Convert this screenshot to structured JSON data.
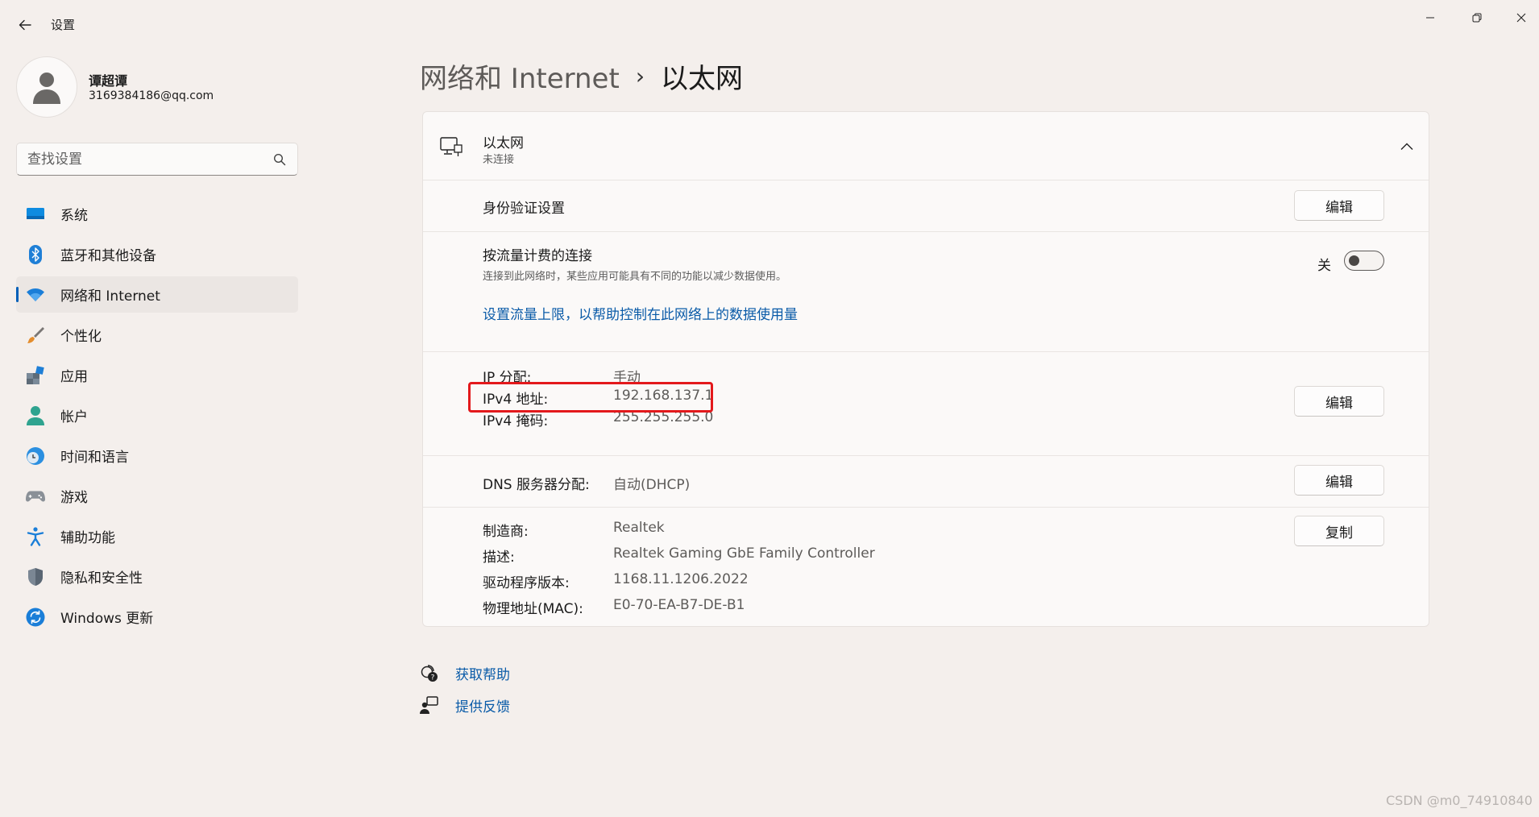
{
  "window": {
    "app_title": "设置",
    "controls": [
      "minimize-icon",
      "maximize-icon",
      "close-icon"
    ]
  },
  "profile": {
    "name": "谭超谭",
    "email": "3169384186@qq.com"
  },
  "search": {
    "placeholder": "查找设置",
    "value": ""
  },
  "sidebar": {
    "active_index": 2,
    "accent_color": "#005fb8",
    "items": [
      {
        "label": "系统",
        "icon": "system-icon"
      },
      {
        "label": "蓝牙和其他设备",
        "icon": "bluetooth-icon"
      },
      {
        "label": "网络和 Internet",
        "icon": "wifi-icon"
      },
      {
        "label": "个性化",
        "icon": "brush-icon"
      },
      {
        "label": "应用",
        "icon": "apps-icon"
      },
      {
        "label": "帐户",
        "icon": "account-icon"
      },
      {
        "label": "时间和语言",
        "icon": "clock-globe-icon"
      },
      {
        "label": "游戏",
        "icon": "gamepad-icon"
      },
      {
        "label": "辅助功能",
        "icon": "accessibility-icon"
      },
      {
        "label": "隐私和安全性",
        "icon": "shield-icon"
      },
      {
        "label": "Windows 更新",
        "icon": "update-icon"
      }
    ]
  },
  "breadcrumb": {
    "parent": "网络和 Internet",
    "separator": "›",
    "current": "以太网"
  },
  "ethernet": {
    "title": "以太网",
    "status": "未连接",
    "auth": {
      "label": "身份验证设置",
      "button": "编辑"
    },
    "metered": {
      "title": "按流量计费的连接",
      "description": "连接到此网络时，某些应用可能具有不同的功能以减少数据使用。",
      "toggle_state": "关",
      "toggle_on": false,
      "link": "设置流量上限，以帮助控制在此网络上的数据使用量"
    },
    "ip": {
      "assignment_label": "IP 分配:",
      "assignment_value": "手动",
      "ipv4_label": "IPv4 地址:",
      "ipv4_value": "192.168.137.1",
      "mask_label": "IPv4 掩码:",
      "mask_value": "255.255.255.0",
      "button": "编辑",
      "highlight_color": "#e3191c"
    },
    "dns": {
      "label": "DNS 服务器分配:",
      "value": "自动(DHCP)",
      "button": "编辑"
    },
    "properties": {
      "manufacturer_label": "制造商:",
      "manufacturer_value": "Realtek",
      "description_label": "描述:",
      "description_value": "Realtek Gaming GbE Family Controller",
      "driver_label": "驱动程序版本:",
      "driver_value": "1168.11.1206.2022",
      "mac_label": "物理地址(MAC):",
      "mac_value": "E0-70-EA-B7-DE-B1",
      "button": "复制"
    }
  },
  "help": {
    "get_help": "获取帮助",
    "feedback": "提供反馈"
  },
  "watermark": "CSDN @m0_74910840"
}
